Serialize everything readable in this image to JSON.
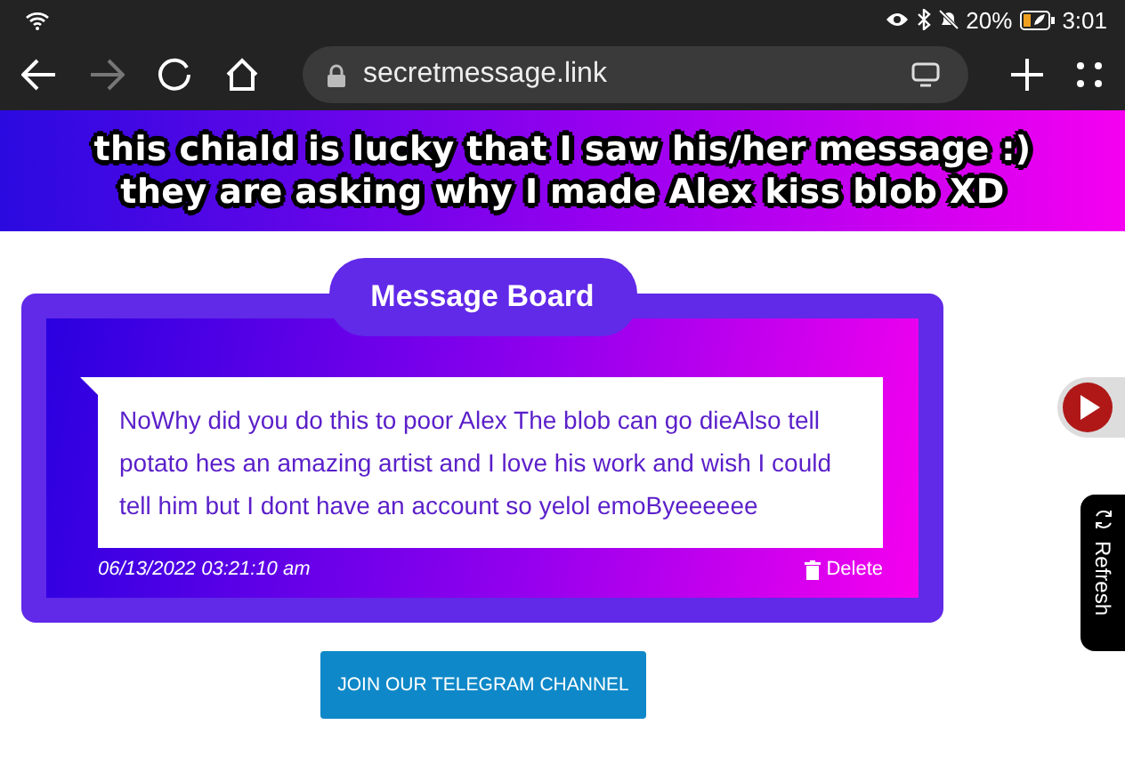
{
  "status_bar": {
    "battery": "20%",
    "time": "3:01"
  },
  "browser": {
    "url": "secretmessage.link",
    "forward_disabled": true
  },
  "caption": {
    "lines": [
      "this chiald is lucky that I saw his/her message :)",
      "they are asking why I made Alex kiss blob XD"
    ]
  },
  "message_board": {
    "title": "Message Board",
    "messages": [
      {
        "text": "NoWhy did you do this to poor Alex The blob can go dieAlso tell potato hes an amazing artist and I love his work and wish I could tell him but I dont have an account so yelol emoByeeeeee",
        "date": "06/13/2022 03:21:10 am",
        "action": "Delete"
      }
    ]
  },
  "refresh_tab": "Refresh",
  "telegram_button": "JOIN OUR TELEGRAM CHANNEL"
}
